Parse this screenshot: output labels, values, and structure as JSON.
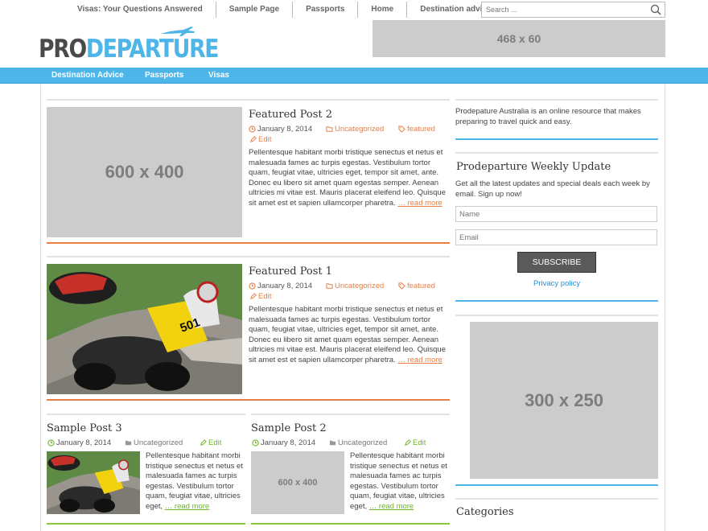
{
  "top_nav": [
    "Visas: Your Questions Answered",
    "Sample Page",
    "Passports",
    "Home",
    "Destination advice"
  ],
  "search": {
    "placeholder": "Search ..."
  },
  "logo": {
    "part1": "PRO",
    "part2": "DEPARTURE"
  },
  "header_ad": "468 x 60",
  "main_nav": [
    "Destination Advice",
    "Passports",
    "Visas"
  ],
  "posts": [
    {
      "title": "Featured Post 2",
      "image": "600 x 400",
      "date": "January 8, 2014",
      "category": "Uncategorized",
      "tag": "featured",
      "edit": "Edit",
      "excerpt": "Pellentesque habitant morbi tristique senectus et netus et malesuada fames ac turpis egestas. Vestibulum tortor quam, feugiat vitae, ultricies eget, tempor sit amet, ante. Donec eu libero sit amet quam egestas semper. Aenean ultricies mi vitae est. Mauris placerat eleifend leo. Quisque sit amet est et sapien ullamcorper pharetra.",
      "more": "… read more"
    },
    {
      "title": "Featured Post 1",
      "date": "January 8, 2014",
      "category": "Uncategorized",
      "tag": "featured",
      "edit": "Edit",
      "excerpt": "Pellentesque habitant morbi tristique senectus et netus et malesuada fames ac turpis egestas. Vestibulum tortor quam, feugiat vitae, ultricies eget, tempor sit amet, ante. Donec eu libero sit amet quam egestas semper. Aenean ultricies mi vitae est. Mauris placerat eleifend leo. Quisque sit amet est et sapien ullamcorper pharetra.",
      "more": "… read more"
    },
    {
      "title": "Sample Post 3",
      "date": "January 8, 2014",
      "category": "Uncategorized",
      "edit": "Edit",
      "excerpt": "Pellentesque habitant morbi tristique senectus et netus et malesuada fames ac turpis egestas. Vestibulum tortor quam, feugiat vitae, ultricies eget,",
      "more": "… read more"
    },
    {
      "title": "Sample Post 2",
      "image": "600 x 400",
      "date": "January 8, 2014",
      "category": "Uncategorized",
      "edit": "Edit",
      "excerpt": "Pellentesque habitant morbi tristique senectus et netus et malesuada fames ac turpis egestas. Vestibulum tortor quam, feugiat vitae, ultricies eget,",
      "more": "… read more"
    }
  ],
  "sidebar": {
    "about": "Prodepature Australia is an online resource that makes preparing to travel quick and easy.",
    "newsletter_title": "Prodeparture Weekly Update",
    "newsletter_text": "Get all the latest updates and special deals each week by email. Sign up now!",
    "name_placeholder": "Name",
    "email_placeholder": "Email",
    "subscribe": "SUBSCRIBE",
    "privacy": "Privacy policy",
    "ad": "300 x 250",
    "categories_title": "Categories"
  },
  "moto_number": "501",
  "colors": {
    "blue": "#4db5e8",
    "orange": "#e87f44",
    "green": "#8cc63f",
    "placeholder": "#cccccc"
  }
}
